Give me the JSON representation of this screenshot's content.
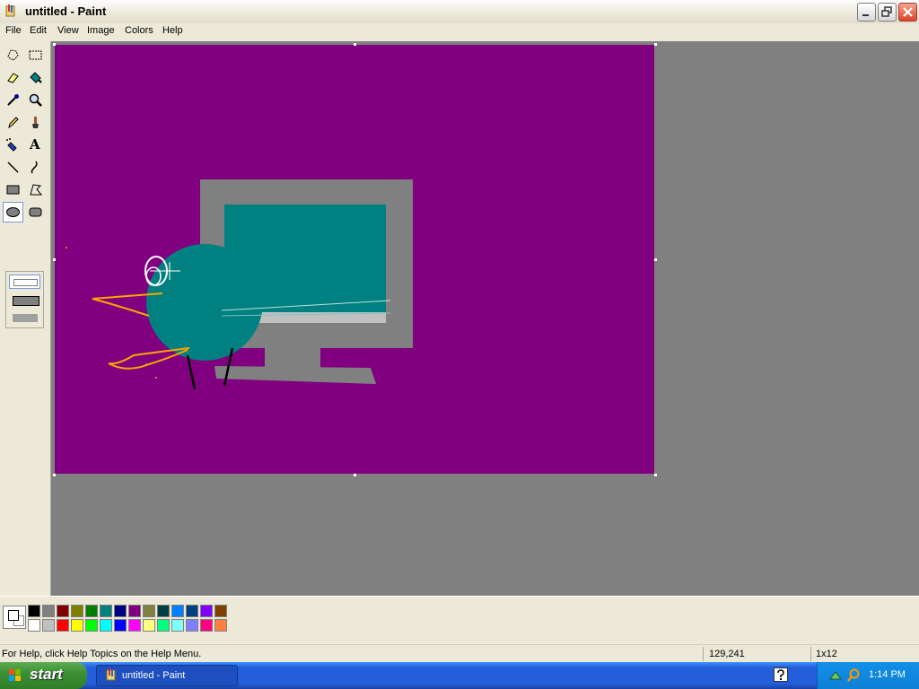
{
  "window": {
    "title": "untitled - Paint"
  },
  "menu": [
    {
      "label": "File"
    },
    {
      "label": "Edit"
    },
    {
      "label": "View"
    },
    {
      "label": "Image"
    },
    {
      "label": "Colors"
    },
    {
      "label": "Help"
    }
  ],
  "tools": [
    {
      "name": "free-form-select-icon",
      "selected": false
    },
    {
      "name": "rectangle-select-icon",
      "selected": false
    },
    {
      "name": "eraser-icon",
      "selected": false
    },
    {
      "name": "fill-bucket-icon",
      "selected": false
    },
    {
      "name": "color-picker-icon",
      "selected": false
    },
    {
      "name": "magnifier-icon",
      "selected": false
    },
    {
      "name": "pencil-icon",
      "selected": false
    },
    {
      "name": "brush-icon",
      "selected": false
    },
    {
      "name": "airbrush-icon",
      "selected": false
    },
    {
      "name": "text-icon",
      "selected": false
    },
    {
      "name": "line-icon",
      "selected": false
    },
    {
      "name": "curve-icon",
      "selected": false
    },
    {
      "name": "rectangle-icon",
      "selected": false
    },
    {
      "name": "polygon-icon",
      "selected": false
    },
    {
      "name": "ellipse-icon",
      "selected": true
    },
    {
      "name": "rounded-rectangle-icon",
      "selected": false
    }
  ],
  "text_tool_glyph": "A",
  "palette": {
    "foreground": "#ffffff",
    "background": "#ffffff",
    "row1": [
      "#000000",
      "#808080",
      "#800000",
      "#808000",
      "#008000",
      "#008080",
      "#000080",
      "#800080",
      "#808040",
      "#004040",
      "#0080ff",
      "#004080",
      "#8000ff",
      "#804000"
    ],
    "row2": [
      "#ffffff",
      "#c0c0c0",
      "#ff0000",
      "#ffff00",
      "#00ff00",
      "#00ffff",
      "#0000ff",
      "#ff00ff",
      "#ffff80",
      "#00ff80",
      "#80ffff",
      "#8080ff",
      "#ff0080",
      "#ff8040"
    ]
  },
  "canvas": {
    "background": "#800080"
  },
  "status": {
    "help": "For Help, click Help Topics on the Help Menu.",
    "coords": "129,241",
    "size": "1x12"
  },
  "taskbar": {
    "start_label": "start",
    "task_label": "untitled - Paint",
    "clock": "1:14 PM"
  }
}
